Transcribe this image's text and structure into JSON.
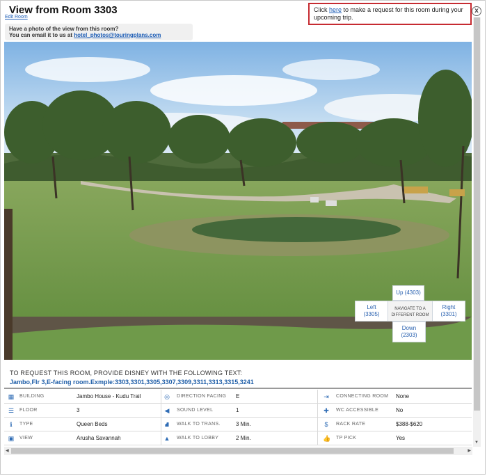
{
  "header": {
    "title": "View from Room 3303",
    "edit_room": "Edit Room",
    "close_glyph": "x"
  },
  "request_notice": {
    "prefix": "Click ",
    "link": "here",
    "suffix": " to make a request for this room during your upcoming trip."
  },
  "photo_prompt": {
    "line1": "Have a photo of the view from this room?",
    "line2_prefix": "You can email it to us at ",
    "email": "hotel_photos@touringplans.com"
  },
  "navigator": {
    "up_label": "Up",
    "up_room": "(4303)",
    "left_label": "Left",
    "left_room": "(3305)",
    "right_label": "Right",
    "right_room": "(3301)",
    "down_label": "Down",
    "down_room": "(2303)",
    "center_line1": "NAVIGATE TO A",
    "center_line2": "DIFFERENT ROOM"
  },
  "request_text": {
    "heading": "TO REQUEST THIS ROOM, PROVIDE DISNEY WITH THE FOLLOWING TEXT:",
    "text": "Jambo,Flr 3,E-facing room.Exmple:3303,3301,3305,3307,3309,3311,3313,3315,3241"
  },
  "info": {
    "rows": [
      [
        {
          "icon": "building-icon",
          "glyph": "▦",
          "label": "BUILDING",
          "value": "Jambo House - Kudu Trail"
        },
        {
          "icon": "compass-icon",
          "glyph": "◎",
          "label": "DIRECTION FACING",
          "value": "E"
        },
        {
          "icon": "arrows-icon",
          "glyph": "⇥",
          "label": "CONNECTING ROOM",
          "value": "None"
        }
      ],
      [
        {
          "icon": "floor-icon",
          "glyph": "☰",
          "label": "FLOOR",
          "value": "3"
        },
        {
          "icon": "sound-icon",
          "glyph": "◀",
          "label": "SOUND LEVEL",
          "value": "1"
        },
        {
          "icon": "wheelchair-icon",
          "glyph": "✚",
          "label": "WC ACCESSIBLE",
          "value": "No"
        }
      ],
      [
        {
          "icon": "info-icon",
          "glyph": "ℹ",
          "label": "TYPE",
          "value": "Queen Beds"
        },
        {
          "icon": "road-icon",
          "glyph": "⛘",
          "label": "WALK TO TRANS.",
          "value": "3 Min."
        },
        {
          "icon": "dollar-icon",
          "glyph": "$",
          "label": "RACK RATE",
          "value": "$388-$620"
        }
      ],
      [
        {
          "icon": "picture-icon",
          "glyph": "▣",
          "label": "VIEW",
          "value": "Arusha Savannah"
        },
        {
          "icon": "bell-icon",
          "glyph": "▲",
          "label": "WALK TO LOBBY",
          "value": "2 Min."
        },
        {
          "icon": "thumbs-up-icon",
          "glyph": "👍",
          "label": "TP PICK",
          "value": "Yes"
        }
      ]
    ]
  },
  "colors": {
    "link": "#1a5bb5",
    "request_border": "#c62b31",
    "icon": "#2f6cb5"
  }
}
